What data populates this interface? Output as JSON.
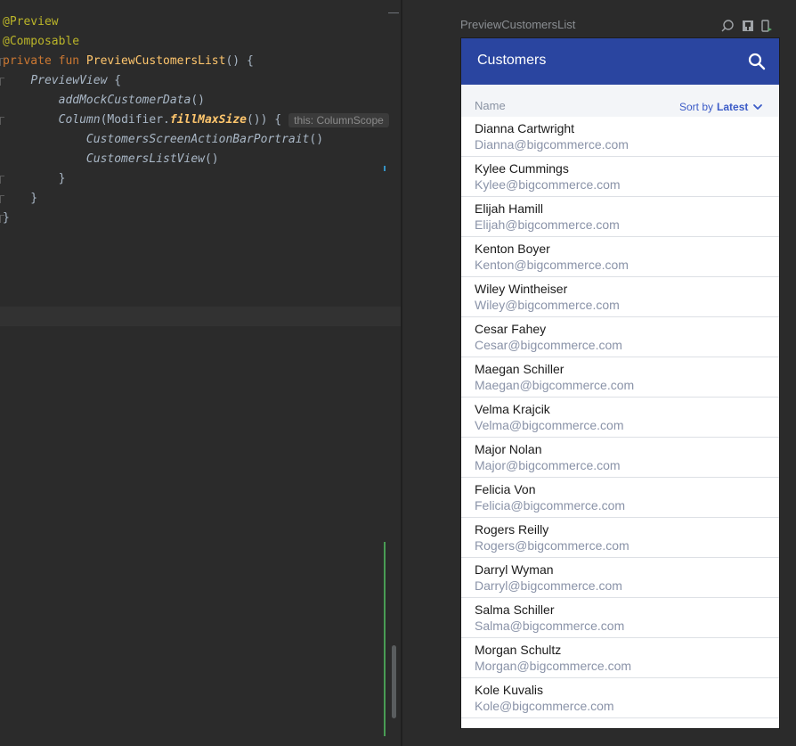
{
  "editor": {
    "lines": [
      {
        "segments": [
          {
            "cls": "ann",
            "text": "@Preview"
          }
        ]
      },
      {
        "segments": [
          {
            "cls": "ann",
            "text": "@Composable"
          }
        ]
      },
      {
        "segments": [
          {
            "cls": "kw",
            "text": "private fun "
          },
          {
            "cls": "fn",
            "text": "PreviewCustomersList"
          },
          {
            "cls": "br",
            "text": "() {"
          }
        ]
      },
      {
        "segments": [
          {
            "cls": "br",
            "text": "    "
          },
          {
            "cls": "it",
            "text": "PreviewView"
          },
          {
            "cls": "br",
            "text": " {"
          }
        ]
      },
      {
        "segments": [
          {
            "cls": "br",
            "text": "        "
          },
          {
            "cls": "it",
            "text": "addMockCustomerData"
          },
          {
            "cls": "br",
            "text": "()"
          }
        ]
      },
      {
        "segments": [
          {
            "cls": "br",
            "text": "        "
          },
          {
            "cls": "it",
            "text": "Column"
          },
          {
            "cls": "br",
            "text": "(Modifier."
          },
          {
            "cls": "it-fn",
            "text": "fillMaxSize"
          },
          {
            "cls": "br",
            "text": "()) {"
          }
        ],
        "hint": "this: ColumnScope"
      },
      {
        "segments": [
          {
            "cls": "br",
            "text": "            "
          },
          {
            "cls": "it",
            "text": "CustomersScreenActionBarPortrait"
          },
          {
            "cls": "br",
            "text": "()"
          }
        ]
      },
      {
        "segments": [
          {
            "cls": "br",
            "text": "            "
          },
          {
            "cls": "it",
            "text": "CustomersListView"
          },
          {
            "cls": "br",
            "text": "()"
          }
        ]
      },
      {
        "segments": [
          {
            "cls": "br",
            "text": "        }"
          }
        ]
      },
      {
        "segments": [
          {
            "cls": "br",
            "text": "    }"
          }
        ]
      },
      {
        "segments": [
          {
            "cls": "br",
            "text": "}"
          }
        ]
      }
    ]
  },
  "preview": {
    "title": "PreviewCustomersList",
    "appbar": {
      "title": "Customers"
    },
    "header": {
      "name_label": "Name",
      "sort_label": "Sort by",
      "sort_value": "Latest"
    },
    "customers": [
      {
        "name": "Dianna Cartwright",
        "email": "Dianna@bigcommerce.com"
      },
      {
        "name": "Kylee Cummings",
        "email": "Kylee@bigcommerce.com"
      },
      {
        "name": "Elijah Hamill",
        "email": "Elijah@bigcommerce.com"
      },
      {
        "name": "Kenton Boyer",
        "email": "Kenton@bigcommerce.com"
      },
      {
        "name": "Wiley Wintheiser",
        "email": "Wiley@bigcommerce.com"
      },
      {
        "name": "Cesar Fahey",
        "email": "Cesar@bigcommerce.com"
      },
      {
        "name": "Maegan Schiller",
        "email": "Maegan@bigcommerce.com"
      },
      {
        "name": "Velma Krajcik",
        "email": "Velma@bigcommerce.com"
      },
      {
        "name": "Major Nolan",
        "email": "Major@bigcommerce.com"
      },
      {
        "name": "Felicia Von",
        "email": "Felicia@bigcommerce.com"
      },
      {
        "name": "Rogers Reilly",
        "email": "Rogers@bigcommerce.com"
      },
      {
        "name": "Darryl Wyman",
        "email": "Darryl@bigcommerce.com"
      },
      {
        "name": "Salma Schiller",
        "email": "Salma@bigcommerce.com"
      },
      {
        "name": "Morgan Schultz",
        "email": "Morgan@bigcommerce.com"
      },
      {
        "name": "Kole Kuvalis",
        "email": "Kole@bigcommerce.com"
      }
    ]
  },
  "colors": {
    "appbar": "#2a45a0",
    "accent": "#3b5bc7",
    "editor_bg": "#2b2b2b"
  },
  "icons": [
    "search-icon",
    "chevron-down-icon",
    "interactive-mode-icon",
    "deploy-icon",
    "device-icon"
  ]
}
